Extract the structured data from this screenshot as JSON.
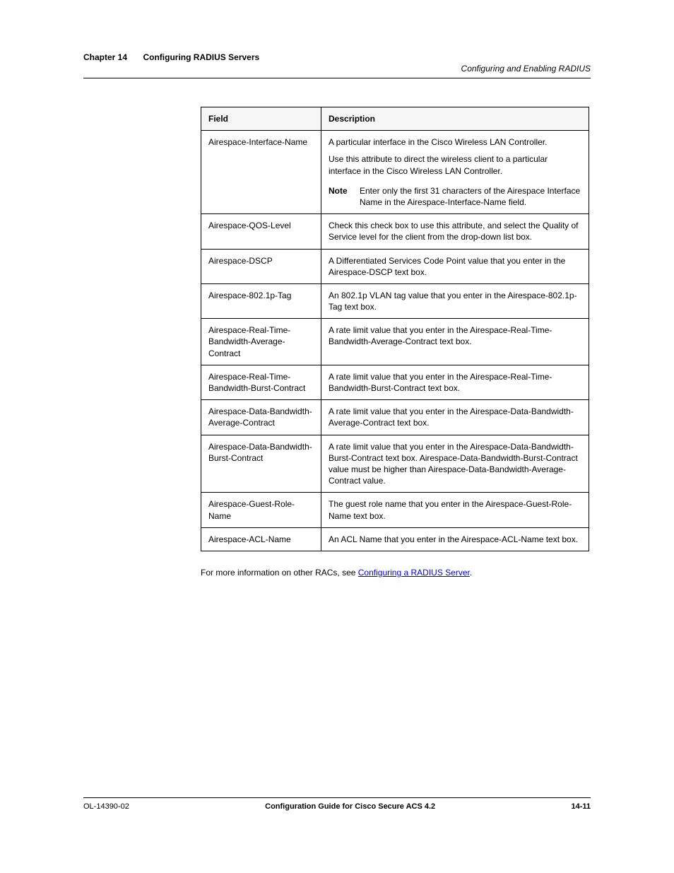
{
  "header": {
    "chapter": "Chapter 14",
    "chapter_title": "Configuring RADIUS Servers",
    "section": "Configuring and Enabling RADIUS"
  },
  "table": {
    "headers": [
      "Field",
      "Description"
    ],
    "rows": [
      {
        "field": "Airespace-Interface-Name",
        "desc_line1": "A particular interface in the Cisco Wireless LAN Controller.",
        "desc_line2": "Use this attribute to direct the wireless client to a particular interface in the Cisco Wireless LAN Controller.",
        "desc_line3_label": "Note",
        "desc_line3_rest": "Enter only the first 31 characters of the Airespace Interface Name in the Airespace-Interface-Name field."
      },
      {
        "field": "Airespace-QOS-Level",
        "desc": "Check this check box to use this attribute, and select the Quality of Service level for the client from the drop-down list box."
      },
      {
        "field": "Airespace-DSCP",
        "desc": "A Differentiated Services Code Point value that you enter in the Airespace-DSCP text box."
      },
      {
        "field": "Airespace-802.1p-Tag",
        "desc": "An 802.1p VLAN tag value that you enter in the Airespace-802.1p-Tag text box."
      },
      {
        "field": "Airespace-Real-Time-Bandwidth-Average-Contract",
        "desc": "A rate limit value that you enter in the Airespace-Real-Time-Bandwidth-Average-Contract text box."
      },
      {
        "field": "Airespace-Real-Time-Bandwidth-Burst-Contract",
        "desc": "A rate limit value that you enter in the Airespace-Real-Time-Bandwidth-Burst-Contract text box."
      },
      {
        "field": "Airespace-Data-Bandwidth-Average-Contract",
        "desc": "A rate limit value that you enter in the Airespace-Data-Bandwidth-Average-Contract text box."
      },
      {
        "field": "Airespace-Data-Bandwidth-Burst-Contract",
        "desc": "A rate limit value that you enter in the Airespace-Data-Bandwidth-Burst-Contract text box. Airespace-Data-Bandwidth-Burst-Contract value must be higher than Airespace-Data-Bandwidth-Average-Contract value."
      },
      {
        "field": "Airespace-Guest-Role-Name",
        "desc": "The guest role name that you enter in the Airespace-Guest-Role-Name text box."
      },
      {
        "field": "Airespace-ACL-Name",
        "desc": "An ACL Name that you enter in the Airespace-ACL-Name text box."
      }
    ]
  },
  "para": {
    "prefix": "For more information on other RACs, see ",
    "link": "Configuring a RADIUS Server",
    "suffix": "."
  },
  "footer": {
    "page": "14-11",
    "doc_title": "Configuration Guide for Cisco Secure ACS 4.2",
    "doc_id": "OL-14390-02"
  }
}
